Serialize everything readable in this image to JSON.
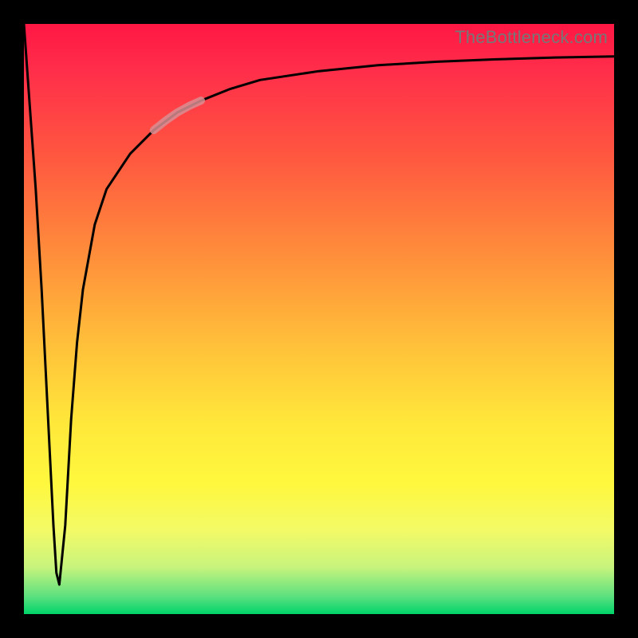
{
  "watermark": "TheBottleneck.com",
  "chart_data": {
    "type": "line",
    "title": "",
    "xlabel": "",
    "ylabel": "",
    "xlim": [
      0,
      100
    ],
    "ylim": [
      0,
      100
    ],
    "grid": false,
    "legend": false,
    "series": [
      {
        "name": "bottleneck-curve",
        "color": "#000000",
        "x": [
          0.0,
          1.0,
          2.0,
          3.0,
          4.0,
          5.0,
          5.5,
          6.0,
          7.0,
          8.0,
          9.0,
          10.0,
          12.0,
          14.0,
          18.0,
          22.0,
          26.0,
          30.0,
          35.0,
          40.0,
          50.0,
          60.0,
          70.0,
          80.0,
          90.0,
          100.0
        ],
        "y": [
          100,
          86,
          72,
          55,
          35,
          15,
          7,
          5,
          15,
          33,
          46,
          55,
          66,
          72,
          78,
          82,
          85,
          87,
          89,
          90.5,
          92,
          93,
          93.6,
          94,
          94.3,
          94.5
        ]
      },
      {
        "name": "highlight-segment",
        "color": "#d88e93",
        "x": [
          22,
          24,
          26,
          28,
          30
        ],
        "y": [
          82,
          83.6,
          85,
          86.1,
          87
        ]
      }
    ]
  }
}
